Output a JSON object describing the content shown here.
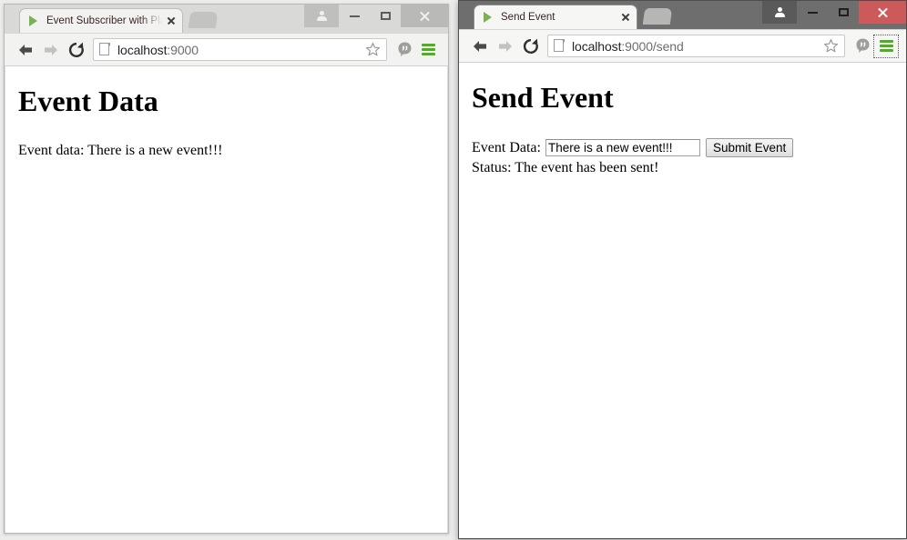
{
  "windows": {
    "left": {
      "tab": {
        "title": "Event Subscriber with Play",
        "favicon": "play-logo-icon",
        "close": "×"
      },
      "toolbar": {
        "back": "back-arrow-icon",
        "forward": "forward-arrow-icon",
        "reload": "reload-icon",
        "url_host": "localhost",
        "url_rest": ":9000",
        "url_full": "localhost:9000",
        "star": "star-icon",
        "hangouts": "hangouts-icon",
        "menu": "hamburger-menu-icon"
      },
      "caption": {
        "avatar": "avatar-icon",
        "minimize": "minimize-icon",
        "maximize": "maximize-icon",
        "close": "close-icon"
      },
      "page": {
        "heading": "Event Data",
        "body": "Event data: There is a new event!!!"
      }
    },
    "right": {
      "tab": {
        "title": "Send Event",
        "favicon": "play-logo-icon",
        "close": "×"
      },
      "toolbar": {
        "back": "back-arrow-icon",
        "forward": "forward-arrow-icon",
        "reload": "reload-icon",
        "url_host": "localhost",
        "url_rest": ":9000/send",
        "url_full": "localhost:9000/send",
        "star": "star-icon",
        "hangouts": "hangouts-icon",
        "menu": "hamburger-menu-icon"
      },
      "caption": {
        "avatar": "avatar-icon",
        "minimize": "minimize-icon",
        "maximize": "maximize-icon",
        "close": "close-icon"
      },
      "page": {
        "heading": "Send Event",
        "form": {
          "label": "Event Data:",
          "input_value": "There is a new event!!!",
          "input_placeholder": "",
          "submit_label": "Submit Event"
        },
        "status": "Status: The event has been sent!"
      }
    }
  },
  "colors": {
    "accent_green": "#4caf1e",
    "close_red": "#cd5a5a",
    "active_frame": "#6e6e6e",
    "inactive_frame": "#d7d7d5",
    "desktop": "#ececeb"
  }
}
